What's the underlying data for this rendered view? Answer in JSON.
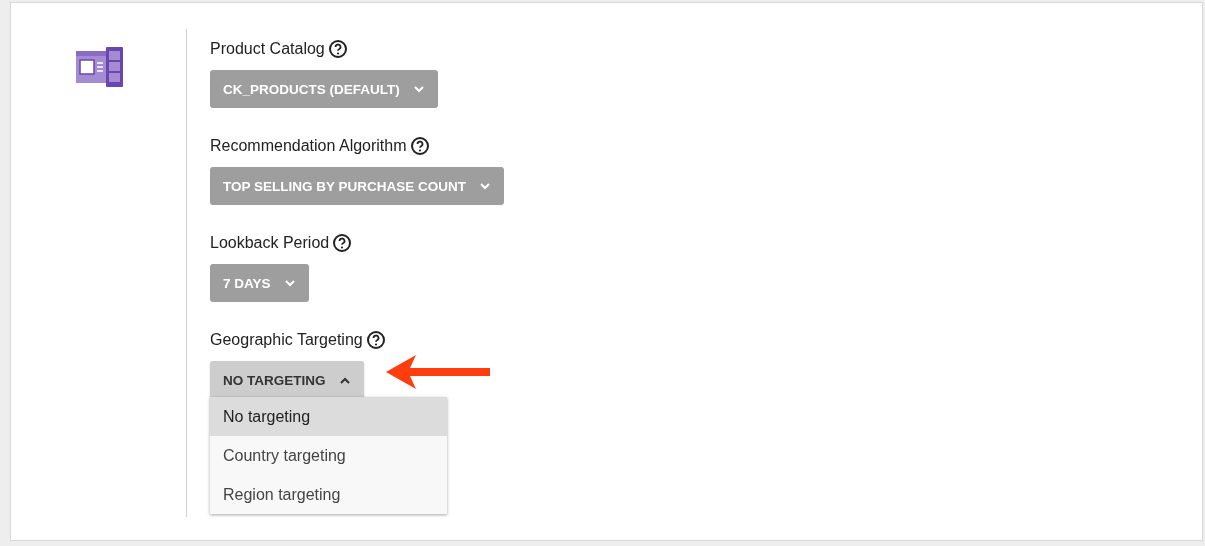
{
  "fields": [
    {
      "label": "Product Catalog",
      "value": "CK_PRODUCTS (DEFAULT)",
      "expanded": false
    },
    {
      "label": "Recommendation Algorithm",
      "value": "TOP SELLING BY PURCHASE COUNT",
      "expanded": false
    },
    {
      "label": "Lookback Period",
      "value": "7 DAYS",
      "expanded": false
    },
    {
      "label": "Geographic Targeting",
      "value": "NO TARGETING",
      "expanded": true,
      "options": [
        {
          "label": "No targeting",
          "selected": true
        },
        {
          "label": "Country targeting",
          "selected": false
        },
        {
          "label": "Region targeting",
          "selected": false
        }
      ]
    }
  ]
}
